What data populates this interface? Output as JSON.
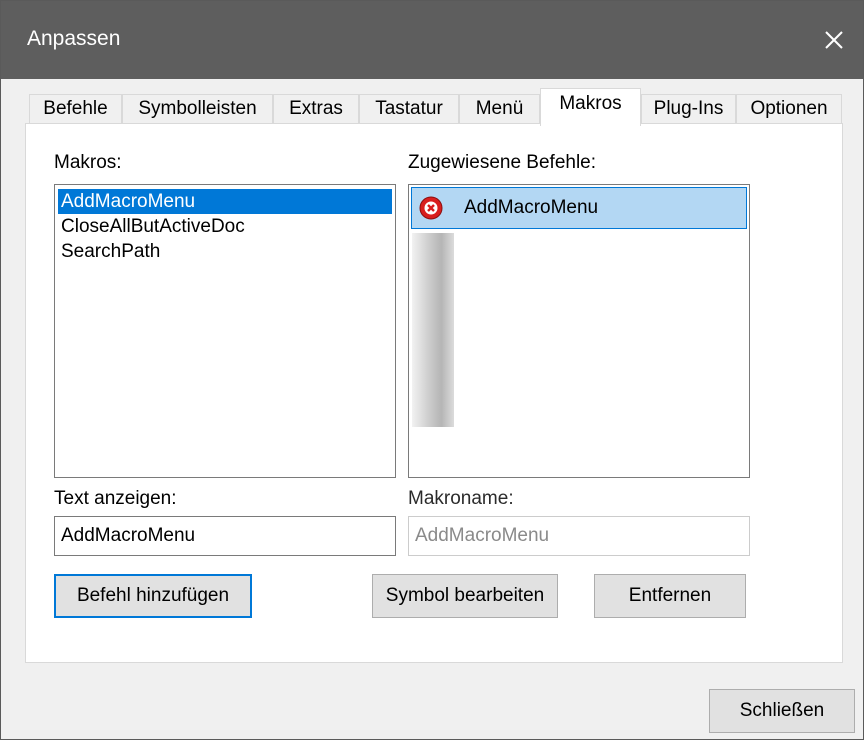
{
  "window": {
    "title": "Anpassen"
  },
  "tabs": [
    {
      "label": "Befehle"
    },
    {
      "label": "Symbolleisten"
    },
    {
      "label": "Extras"
    },
    {
      "label": "Tastatur"
    },
    {
      "label": "Menü"
    },
    {
      "label": "Makros",
      "active": true
    },
    {
      "label": "Plug-Ins"
    },
    {
      "label": "Optionen"
    }
  ],
  "macros": {
    "label": "Makros:",
    "items": [
      "AddMacroMenu",
      "CloseAllButActiveDoc",
      "SearchPath"
    ],
    "selected": "AddMacroMenu"
  },
  "assigned": {
    "label": "Zugewiesene Befehle:",
    "items": [
      {
        "label": "AddMacroMenu",
        "icon": "macro-error-icon"
      }
    ]
  },
  "display_text": {
    "label": "Text anzeigen:",
    "value": "AddMacroMenu"
  },
  "macro_name": {
    "label": "Makroname:",
    "value": "AddMacroMenu"
  },
  "buttons": {
    "add_command": "Befehl hinzufügen",
    "edit_symbol": "Symbol bearbeiten",
    "remove": "Entfernen",
    "close": "Schließen"
  },
  "colors": {
    "titlebar": "#5e5e5e",
    "selection": "#0078d7",
    "selection_light": "#b3d7f3",
    "error_icon": "#d81e1e"
  }
}
